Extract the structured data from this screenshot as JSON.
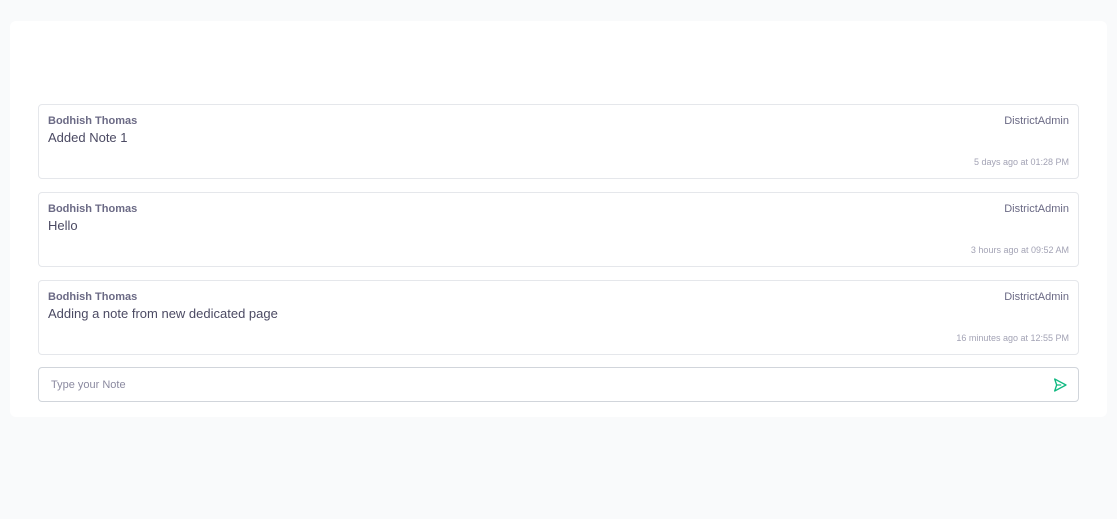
{
  "notes": [
    {
      "author": "Bodhish Thomas",
      "role": "DistrictAdmin",
      "text": "Added Note 1",
      "time": "5 days ago at 01:28 PM"
    },
    {
      "author": "Bodhish Thomas",
      "role": "DistrictAdmin",
      "text": "Hello",
      "time": "3 hours ago at 09:52 AM"
    },
    {
      "author": "Bodhish Thomas",
      "role": "DistrictAdmin",
      "text": "Adding a note from new dedicated page",
      "time": "16 minutes ago at 12:55 PM"
    }
  ],
  "composer": {
    "placeholder": "Type your Note",
    "value": "",
    "send_icon": "send-icon",
    "send_color": "#10b981"
  }
}
